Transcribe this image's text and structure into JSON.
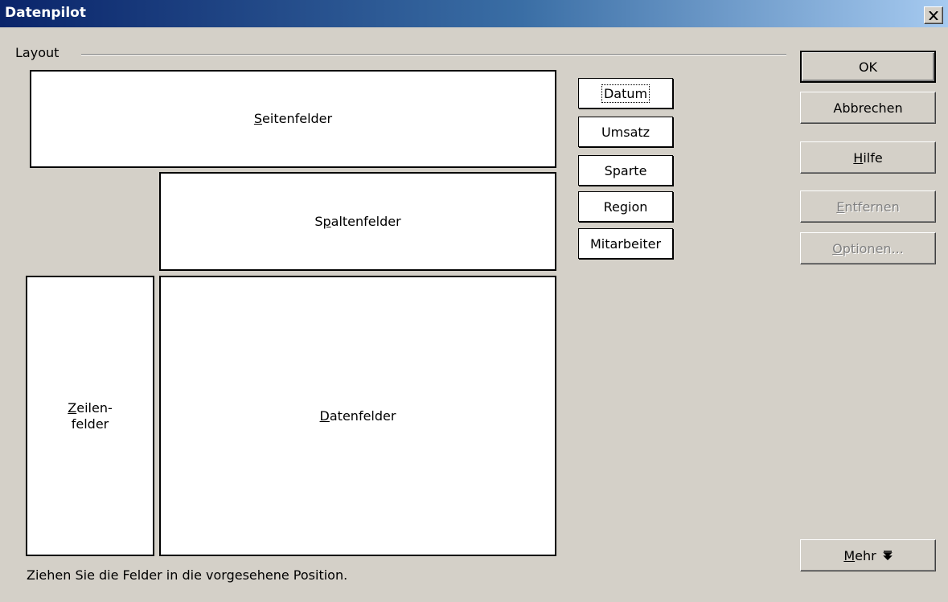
{
  "window": {
    "title": "Datenpilot"
  },
  "layout": {
    "group_label": "Layout",
    "page_fields": {
      "pre": "",
      "key": "S",
      "post": "eitenfelder"
    },
    "column_fields": {
      "pre": "S",
      "key": "p",
      "post": "altenfelder"
    },
    "row_fields": {
      "pre": "",
      "key": "Z",
      "post": "eilen-\nfelder"
    },
    "data_fields": {
      "pre": "",
      "key": "D",
      "post": "atenfelder"
    },
    "available_fields": [
      "Datum",
      "Umsatz",
      "Sparte",
      "Region",
      "Mitarbeiter"
    ],
    "hint": "Ziehen Sie die Felder in die vorgesehene Position."
  },
  "buttons": {
    "ok": "OK",
    "cancel": "Abbrechen",
    "help": {
      "pre": "",
      "key": "H",
      "post": "ilfe"
    },
    "remove": {
      "pre": "",
      "key": "E",
      "post": "ntfernen"
    },
    "options": {
      "pre": "",
      "key": "O",
      "post": "ptionen..."
    },
    "more": {
      "pre": "",
      "key": "M",
      "post": "ehr"
    }
  }
}
